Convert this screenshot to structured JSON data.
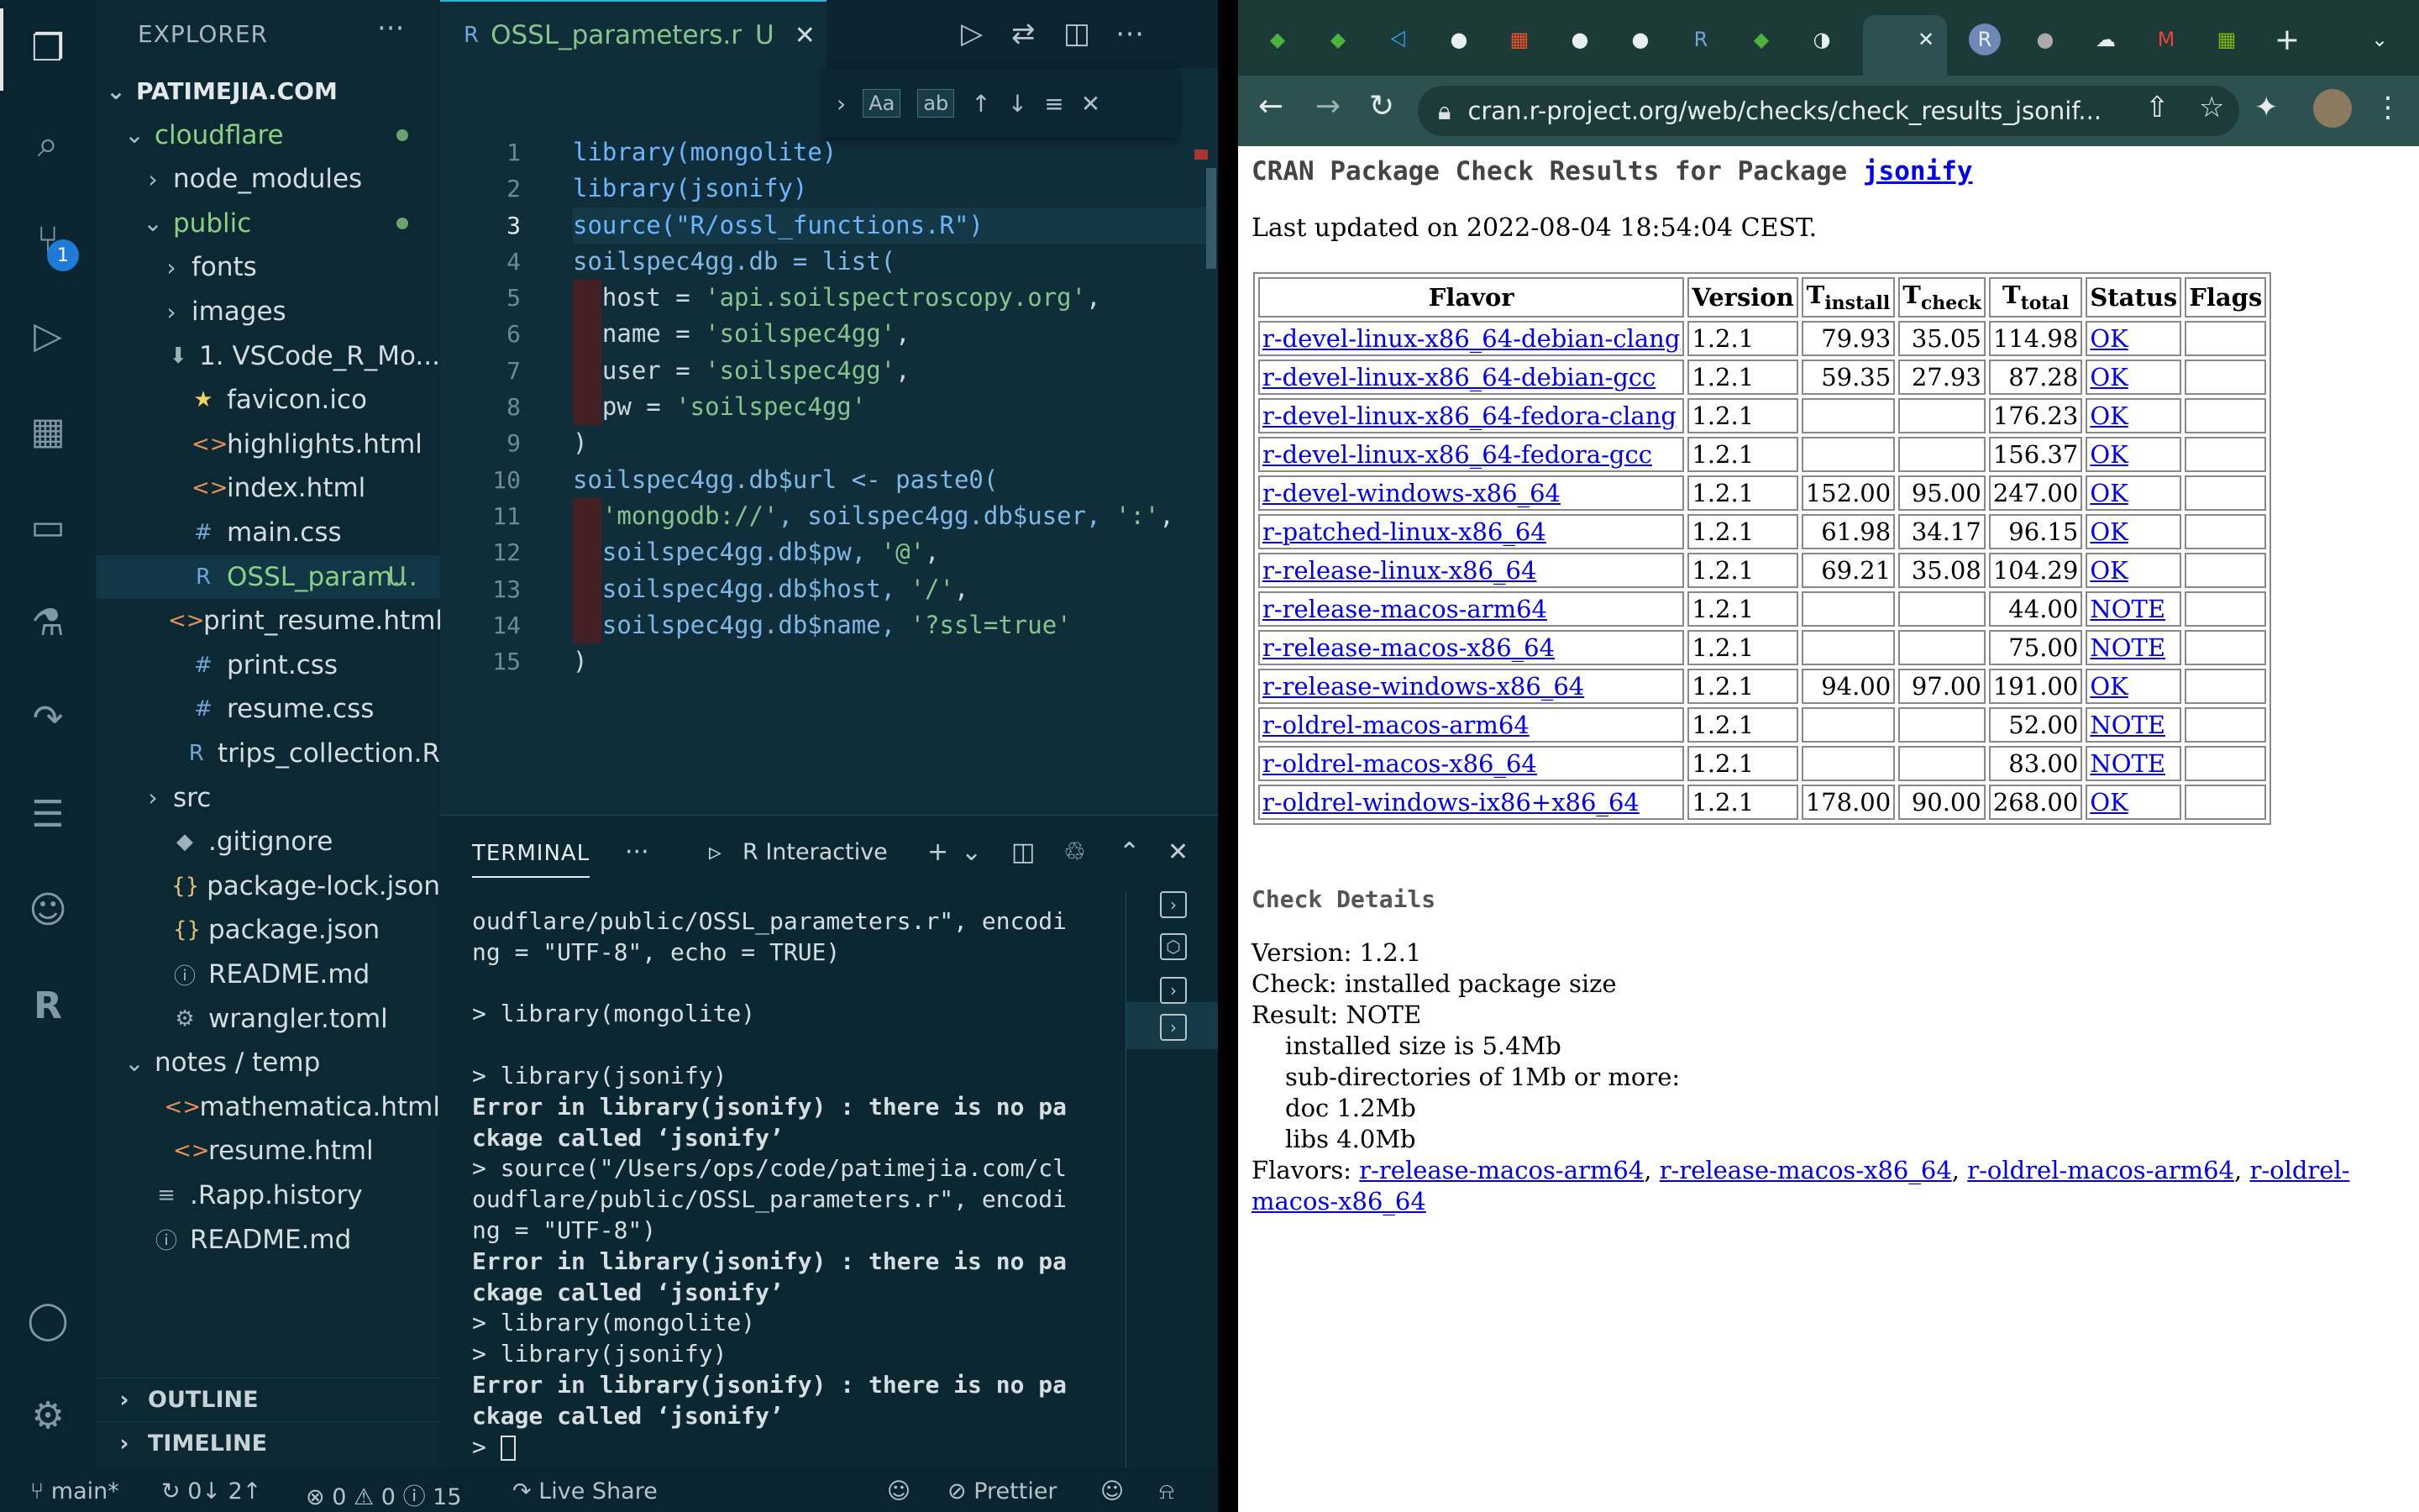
{
  "vscode": {
    "sidebar": {
      "header": "EXPLORER",
      "more": "···",
      "tree": [
        {
          "label": "PATIMEJIA.COM",
          "arrow": "⌄",
          "icon": "",
          "depth": 0,
          "bold": true
        },
        {
          "label": "cloudflare",
          "arrow": "⌄",
          "icon": "",
          "depth": 1,
          "green": true,
          "dot": true
        },
        {
          "label": "node_modules",
          "arrow": "›",
          "icon": "",
          "depth": 2
        },
        {
          "label": "public",
          "arrow": "⌄",
          "icon": "",
          "depth": 2,
          "green": true,
          "dot": true
        },
        {
          "label": "fonts",
          "arrow": "›",
          "icon": "",
          "depth": 3
        },
        {
          "label": "images",
          "arrow": "›",
          "icon": "",
          "depth": 3
        },
        {
          "label": "1. VSCode_R_Mo...",
          "arrow": "",
          "icon": "⬇",
          "depth": 3
        },
        {
          "label": "favicon.ico",
          "arrow": "",
          "icon": "★",
          "depth": 3
        },
        {
          "label": "highlights.html",
          "arrow": "",
          "icon": "<>",
          "depth": 3
        },
        {
          "label": "index.html",
          "arrow": "",
          "icon": "<>",
          "depth": 3
        },
        {
          "label": "main.css",
          "arrow": "",
          "icon": "#",
          "depth": 3
        },
        {
          "label": "OSSL_param...",
          "arrow": "",
          "icon": "R",
          "depth": 3,
          "green": true,
          "tag": "U",
          "selected": true
        },
        {
          "label": "print_resume.html",
          "arrow": "",
          "icon": "<>",
          "depth": 3
        },
        {
          "label": "print.css",
          "arrow": "",
          "icon": "#",
          "depth": 3
        },
        {
          "label": "resume.css",
          "arrow": "",
          "icon": "#",
          "depth": 3
        },
        {
          "label": "trips_collection.R",
          "arrow": "",
          "icon": "R",
          "depth": 3
        },
        {
          "label": "src",
          "arrow": "›",
          "icon": "",
          "depth": 2
        },
        {
          "label": ".gitignore",
          "arrow": "",
          "icon": "◆",
          "depth": 2
        },
        {
          "label": "package-lock.json",
          "arrow": "",
          "icon": "{}",
          "depth": 2
        },
        {
          "label": "package.json",
          "arrow": "",
          "icon": "{}",
          "depth": 2
        },
        {
          "label": "README.md",
          "arrow": "",
          "icon": "ⓘ",
          "depth": 2
        },
        {
          "label": "wrangler.toml",
          "arrow": "",
          "icon": "⚙",
          "depth": 2
        },
        {
          "label": "notes / temp",
          "arrow": "⌄",
          "icon": "",
          "depth": 1
        },
        {
          "label": "mathematica.html",
          "arrow": "",
          "icon": "<>",
          "depth": 2
        },
        {
          "label": "resume.html",
          "arrow": "",
          "icon": "<>",
          "depth": 2
        },
        {
          "label": ".Rapp.history",
          "arrow": "",
          "icon": "≡",
          "depth": 1
        },
        {
          "label": "README.md",
          "arrow": "",
          "icon": "ⓘ",
          "depth": 1
        }
      ],
      "outline": "OUTLINE",
      "timeline": "TIMELINE"
    },
    "tab": {
      "label": "OSSL_parameters.r",
      "modified": "U"
    },
    "find_options": [
      "Aa",
      "ab"
    ],
    "code_lines": [
      "library(mongolite)",
      "library(jsonify)",
      "source(\"R/ossl_functions.R\")",
      "soilspec4gg.db = list(",
      "  host = 'api.soilspectroscopy.org',",
      "  name = 'soilspec4gg',",
      "  user = 'soilspec4gg',",
      "  pw = 'soilspec4gg'",
      ")",
      "soilspec4gg.db$url <- paste0(",
      "  'mongodb://', soilspec4gg.db$user, ':',",
      "  soilspec4gg.db$pw, '@',",
      "  soilspec4gg.db$host, '/',",
      "  soilspec4gg.db$name, '?ssl=true'",
      ")"
    ],
    "line_numbers": [
      "1",
      "2",
      "3",
      "4",
      "5",
      "6",
      "7",
      "8",
      "9",
      "10",
      "11",
      "12",
      "13",
      "14",
      "15"
    ],
    "panel": {
      "tab": "TERMINAL",
      "more": "···",
      "terminal_name": "R Interactive",
      "lines": [
        {
          "t": "oudflare/public/OSSL_parameters.r\", encodi",
          "err": false
        },
        {
          "t": "ng = \"UTF-8\", echo = TRUE)",
          "err": false
        },
        {
          "t": "",
          "err": false
        },
        {
          "t": "> library(mongolite)",
          "err": false
        },
        {
          "t": "",
          "err": false
        },
        {
          "t": "> library(jsonify)",
          "err": false
        },
        {
          "t": "Error in library(jsonify) : there is no pa",
          "err": true
        },
        {
          "t": "ckage called ‘jsonify’",
          "err": true
        },
        {
          "t": "> source(\"/Users/ops/code/patimejia.com/cl",
          "err": false
        },
        {
          "t": "oudflare/public/OSSL_parameters.r\", encodi",
          "err": false
        },
        {
          "t": "ng = \"UTF-8\")",
          "err": false
        },
        {
          "t": "Error in library(jsonify) : there is no pa",
          "err": true
        },
        {
          "t": "ckage called ‘jsonify’",
          "err": true
        },
        {
          "t": "> library(mongolite)",
          "err": false
        },
        {
          "t": "> library(jsonify)",
          "err": false
        },
        {
          "t": "Error in library(jsonify) : there is no pa",
          "err": true
        },
        {
          "t": "ckage called ‘jsonify’",
          "err": true
        }
      ],
      "prompt": "> "
    },
    "status": {
      "branch": "main*",
      "sync": "0↓ 2↑",
      "errors": "0",
      "warnings": "0",
      "info": "15",
      "live_share": "Live Share",
      "prettier": "Prettier"
    },
    "scm_badge": "1"
  },
  "chrome": {
    "url": "cran.r-project.org/web/checks/check_results_jsonif...",
    "page": {
      "title_prefix": "CRAN Package Check Results for Package",
      "title_link": "jsonify",
      "last_updated": "Last updated on 2022-08-04 18:54:04 CEST.",
      "table_headers": {
        "flavor": "Flavor",
        "version": "Version",
        "t": "T",
        "install": "install",
        "check": "check",
        "total": "total",
        "status": "Status",
        "flags": "Flags"
      },
      "rows": [
        {
          "flavor": "r-devel-linux-x86_64-debian-clang",
          "version": "1.2.1",
          "install": "79.93",
          "check": "35.05",
          "total": "114.98",
          "status": "OK"
        },
        {
          "flavor": "r-devel-linux-x86_64-debian-gcc",
          "version": "1.2.1",
          "install": "59.35",
          "check": "27.93",
          "total": "87.28",
          "status": "OK"
        },
        {
          "flavor": "r-devel-linux-x86_64-fedora-clang",
          "version": "1.2.1",
          "install": "",
          "check": "",
          "total": "176.23",
          "status": "OK"
        },
        {
          "flavor": "r-devel-linux-x86_64-fedora-gcc",
          "version": "1.2.1",
          "install": "",
          "check": "",
          "total": "156.37",
          "status": "OK"
        },
        {
          "flavor": "r-devel-windows-x86_64",
          "version": "1.2.1",
          "install": "152.00",
          "check": "95.00",
          "total": "247.00",
          "status": "OK"
        },
        {
          "flavor": "r-patched-linux-x86_64",
          "version": "1.2.1",
          "install": "61.98",
          "check": "34.17",
          "total": "96.15",
          "status": "OK"
        },
        {
          "flavor": "r-release-linux-x86_64",
          "version": "1.2.1",
          "install": "69.21",
          "check": "35.08",
          "total": "104.29",
          "status": "OK"
        },
        {
          "flavor": "r-release-macos-arm64",
          "version": "1.2.1",
          "install": "",
          "check": "",
          "total": "44.00",
          "status": "NOTE"
        },
        {
          "flavor": "r-release-macos-x86_64",
          "version": "1.2.1",
          "install": "",
          "check": "",
          "total": "75.00",
          "status": "NOTE"
        },
        {
          "flavor": "r-release-windows-x86_64",
          "version": "1.2.1",
          "install": "94.00",
          "check": "97.00",
          "total": "191.00",
          "status": "OK"
        },
        {
          "flavor": "r-oldrel-macos-arm64",
          "version": "1.2.1",
          "install": "",
          "check": "",
          "total": "52.00",
          "status": "NOTE"
        },
        {
          "flavor": "r-oldrel-macos-x86_64",
          "version": "1.2.1",
          "install": "",
          "check": "",
          "total": "83.00",
          "status": "NOTE"
        },
        {
          "flavor": "r-oldrel-windows-ix86+x86_64",
          "version": "1.2.1",
          "install": "178.00",
          "check": "90.00",
          "total": "268.00",
          "status": "OK"
        }
      ],
      "check_details_title": "Check Details",
      "details": {
        "version": "Version: 1.2.1",
        "check": "Check: installed package size",
        "result": "Result: NOTE",
        "lines": [
          "installed size is 5.4Mb",
          "sub-directories of 1Mb or more:",
          "doc 1.2Mb",
          "libs 4.0Mb"
        ],
        "flavors_label": "Flavors:",
        "flavors": [
          "r-release-macos-arm64",
          "r-release-macos-x86_64",
          "r-oldrel-macos-arm64",
          "r-oldrel-macos-x86_64"
        ]
      }
    }
  }
}
